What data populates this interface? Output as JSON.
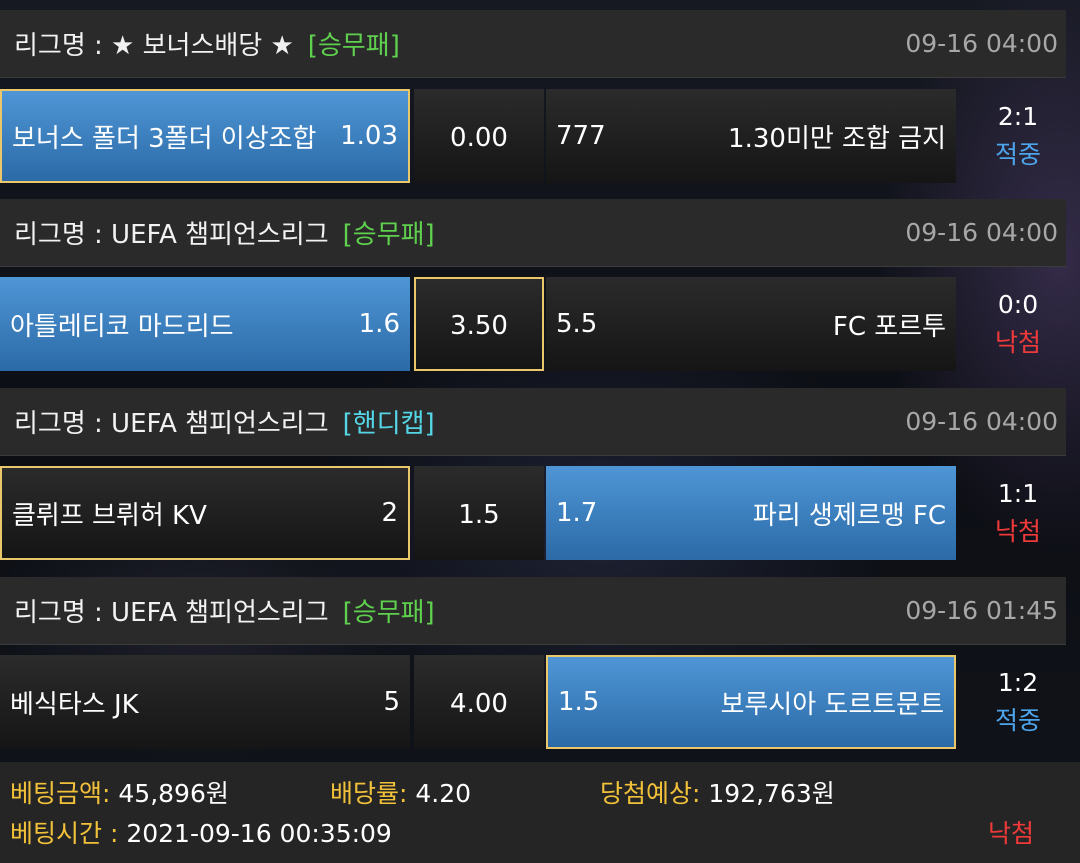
{
  "matches": [
    {
      "league": "리그명 : ★ 보너스배당 ★",
      "type": "[승무패]",
      "time": "09-16 04:00",
      "home_name": "보너스 폴더 3폴더 이상조합",
      "home_odds": "1.03",
      "draw": "0.00",
      "away_odds": "777",
      "away_name": "1.30미만 조합 금지",
      "score": "2:1",
      "status": "적중"
    },
    {
      "league": "리그명 : UEFA 챔피언스리그",
      "type": "[승무패]",
      "time": "09-16 04:00",
      "home_name": "아틀레티코 마드리드",
      "home_odds": "1.6",
      "draw": "3.50",
      "away_odds": "5.5",
      "away_name": "FC 포르투",
      "score": "0:0",
      "status": "낙첨"
    },
    {
      "league": "리그명 : UEFA 챔피언스리그",
      "type": "[핸디캡]",
      "time": "09-16 04:00",
      "home_name": "클뤼프 브뤼허 KV",
      "home_odds": "2",
      "draw": "1.5",
      "away_odds": "1.7",
      "away_name": "파리 생제르맹 FC",
      "score": "1:1",
      "status": "낙첨"
    },
    {
      "league": "리그명 : UEFA 챔피언스리그",
      "type": "[승무패]",
      "time": "09-16 01:45",
      "home_name": "베식타스 JK",
      "home_odds": "5",
      "draw": "4.00",
      "away_odds": "1.5",
      "away_name": "보루시아 도르트문트",
      "score": "1:2",
      "status": "적중"
    }
  ],
  "summary": {
    "amount_label": "베팅금액:",
    "amount_value": " 45,896원",
    "rate_label": "배당률:",
    "rate_value": " 4.20",
    "expected_label": "당첨예상:",
    "expected_value": " 192,763원",
    "time_label": "베팅시간 :",
    "time_value": " 2021-09-16 00:35:09",
    "result": "낙첨"
  },
  "colors": {
    "win_status": "#4da4ea",
    "lose_status": "#f03a3a",
    "selected_border": "#e9c76a",
    "label_yellow": "#f2c13a",
    "type_green": "#5fcf4e",
    "type_cyan": "#55d6e6"
  }
}
